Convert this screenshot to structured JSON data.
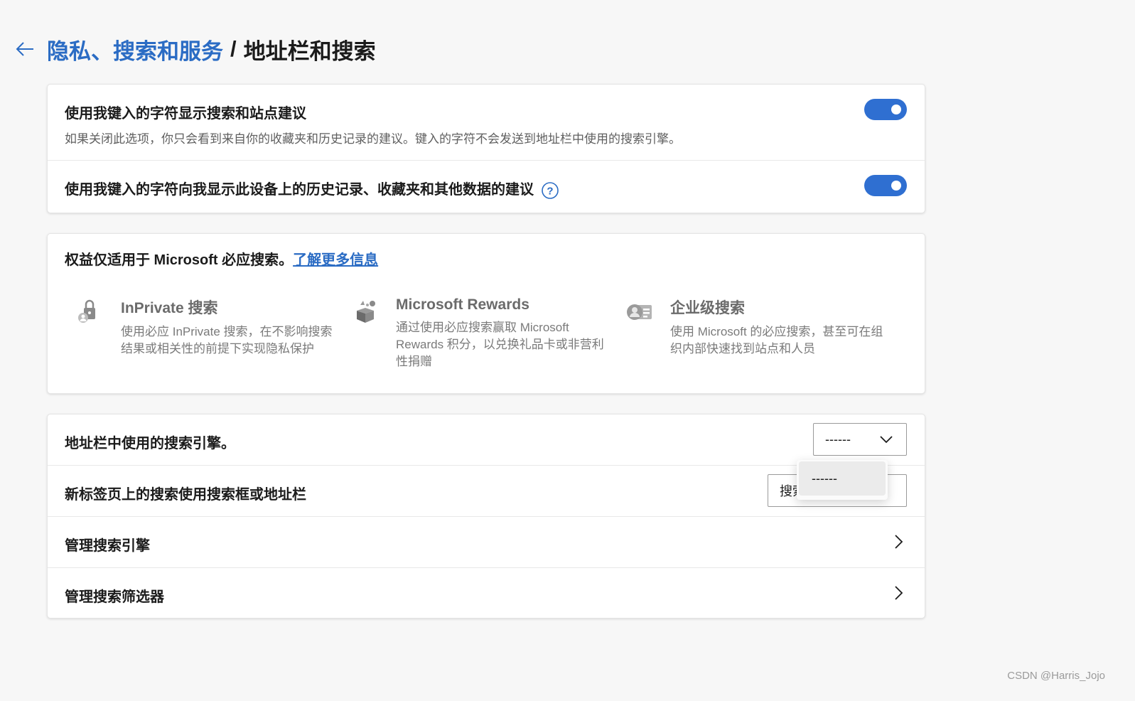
{
  "header": {
    "back_icon": "arrow-left-icon",
    "crumb_parent": "隐私、搜索和服务",
    "separator": "/",
    "crumb_current": "地址栏和搜索"
  },
  "suggestions": {
    "item1_title": "使用我键入的字符显示搜索和站点建议",
    "item1_desc": "如果关闭此选项，你只会看到来自你的收藏夹和历史记录的建议。键入的字符不会发送到地址栏中使用的搜索引擎。",
    "item1_on": true,
    "item2_title": "使用我键入的字符向我显示此设备上的历史记录、收藏夹和其他数据的建议",
    "item2_on": true
  },
  "benefits": {
    "heading": "权益仅适用于 Microsoft 必应搜索。",
    "link": "了解更多信息",
    "features": [
      {
        "icon": "lock-user-icon",
        "title": "InPrivate 搜索",
        "desc": "使用必应 InPrivate 搜索，在不影响搜索结果或相关性的前提下实现隐私保护"
      },
      {
        "icon": "gift-box-icon",
        "title": "Microsoft Rewards",
        "desc": "通过使用必应搜索赢取 Microsoft Rewards 积分，以兑换礼品卡或非营利性捐赠"
      },
      {
        "icon": "id-card-icon",
        "title": "企业级搜索",
        "desc": "使用 Microsoft 的必应搜索，甚至可在组织内部快速找到站点和人员"
      }
    ]
  },
  "search": {
    "engine_label": "地址栏中使用的搜索引擎。",
    "engine_value": "------",
    "newtab_label": "新标签页上的搜索使用搜索框或地址栏",
    "newtab_value": "搜索框",
    "manage_engines": "管理搜索引擎",
    "manage_filters": "管理搜索筛选器",
    "dropdown_option": "------"
  },
  "colors": {
    "accent": "#2f6fd1",
    "link": "#2b6cc4"
  },
  "watermark": "CSDN @Harris_Jojo"
}
